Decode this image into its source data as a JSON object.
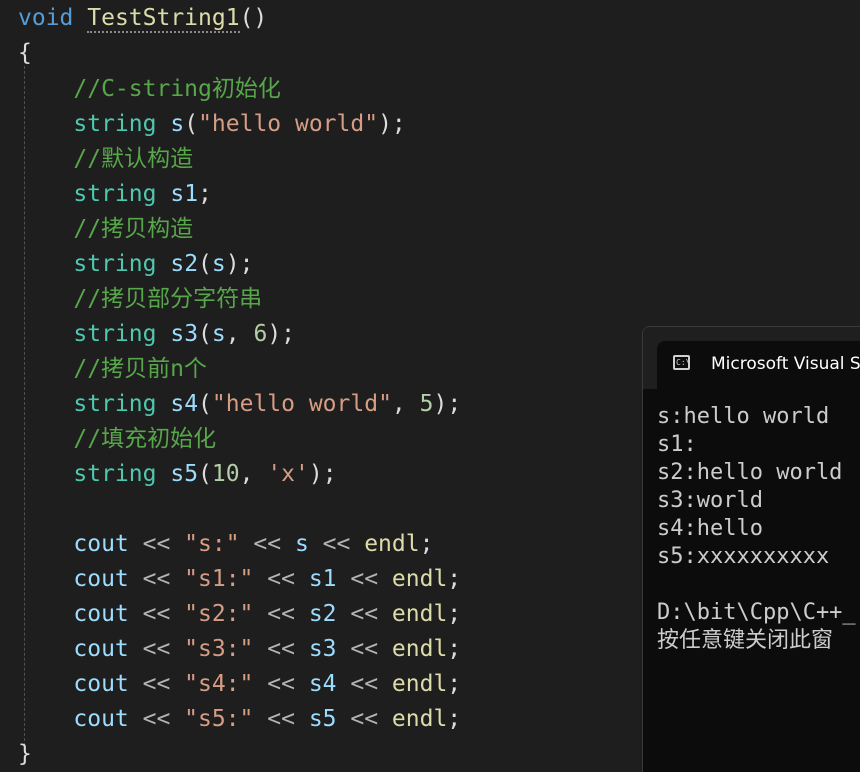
{
  "editor": {
    "lines": [
      {
        "spans": [
          {
            "t": "void",
            "c": "kw"
          },
          {
            "t": " ",
            "c": "pn"
          },
          {
            "t": "TestString1",
            "c": "fn",
            "u": true
          },
          {
            "t": "()",
            "c": "pn"
          }
        ]
      },
      {
        "spans": [
          {
            "t": "{",
            "c": "pn"
          }
        ]
      },
      {
        "spans": [
          {
            "t": "    ",
            "c": "pn"
          },
          {
            "t": "//C-string初始化",
            "c": "cm"
          }
        ]
      },
      {
        "spans": [
          {
            "t": "    ",
            "c": "pn"
          },
          {
            "t": "string",
            "c": "ty"
          },
          {
            "t": " ",
            "c": "pn"
          },
          {
            "t": "s",
            "c": "vr"
          },
          {
            "t": "(",
            "c": "pn"
          },
          {
            "t": "\"hello world\"",
            "c": "st"
          },
          {
            "t": ");",
            "c": "pn"
          }
        ]
      },
      {
        "spans": [
          {
            "t": "    ",
            "c": "pn"
          },
          {
            "t": "//默认构造",
            "c": "cm"
          }
        ]
      },
      {
        "spans": [
          {
            "t": "    ",
            "c": "pn"
          },
          {
            "t": "string",
            "c": "ty"
          },
          {
            "t": " ",
            "c": "pn"
          },
          {
            "t": "s1",
            "c": "vr"
          },
          {
            "t": ";",
            "c": "pn"
          }
        ]
      },
      {
        "spans": [
          {
            "t": "    ",
            "c": "pn"
          },
          {
            "t": "//拷贝构造",
            "c": "cm"
          }
        ]
      },
      {
        "spans": [
          {
            "t": "    ",
            "c": "pn"
          },
          {
            "t": "string",
            "c": "ty"
          },
          {
            "t": " ",
            "c": "pn"
          },
          {
            "t": "s2",
            "c": "vr"
          },
          {
            "t": "(",
            "c": "pn"
          },
          {
            "t": "s",
            "c": "vr"
          },
          {
            "t": ");",
            "c": "pn"
          }
        ]
      },
      {
        "spans": [
          {
            "t": "    ",
            "c": "pn"
          },
          {
            "t": "//拷贝部分字符串",
            "c": "cm"
          }
        ]
      },
      {
        "spans": [
          {
            "t": "    ",
            "c": "pn"
          },
          {
            "t": "string",
            "c": "ty"
          },
          {
            "t": " ",
            "c": "pn"
          },
          {
            "t": "s3",
            "c": "vr"
          },
          {
            "t": "(",
            "c": "pn"
          },
          {
            "t": "s",
            "c": "vr"
          },
          {
            "t": ", ",
            "c": "pn"
          },
          {
            "t": "6",
            "c": "nm"
          },
          {
            "t": ");",
            "c": "pn"
          }
        ]
      },
      {
        "spans": [
          {
            "t": "    ",
            "c": "pn"
          },
          {
            "t": "//拷贝前n个",
            "c": "cm"
          }
        ]
      },
      {
        "spans": [
          {
            "t": "    ",
            "c": "pn"
          },
          {
            "t": "string",
            "c": "ty"
          },
          {
            "t": " ",
            "c": "pn"
          },
          {
            "t": "s4",
            "c": "vr"
          },
          {
            "t": "(",
            "c": "pn"
          },
          {
            "t": "\"hello world\"",
            "c": "st"
          },
          {
            "t": ", ",
            "c": "pn"
          },
          {
            "t": "5",
            "c": "nm"
          },
          {
            "t": ");",
            "c": "pn"
          }
        ]
      },
      {
        "spans": [
          {
            "t": "    ",
            "c": "pn"
          },
          {
            "t": "//填充初始化",
            "c": "cm"
          }
        ]
      },
      {
        "spans": [
          {
            "t": "    ",
            "c": "pn"
          },
          {
            "t": "string",
            "c": "ty"
          },
          {
            "t": " ",
            "c": "pn"
          },
          {
            "t": "s5",
            "c": "vr"
          },
          {
            "t": "(",
            "c": "pn"
          },
          {
            "t": "10",
            "c": "nm"
          },
          {
            "t": ", ",
            "c": "pn"
          },
          {
            "t": "'x'",
            "c": "st"
          },
          {
            "t": ");",
            "c": "pn"
          }
        ]
      },
      {
        "spans": []
      },
      {
        "spans": [
          {
            "t": "    ",
            "c": "pn"
          },
          {
            "t": "cout",
            "c": "vr"
          },
          {
            "t": " << ",
            "c": "op"
          },
          {
            "t": "\"s:\"",
            "c": "st"
          },
          {
            "t": " << ",
            "c": "op"
          },
          {
            "t": "s",
            "c": "vr"
          },
          {
            "t": " << ",
            "c": "op"
          },
          {
            "t": "endl",
            "c": "fn"
          },
          {
            "t": ";",
            "c": "pn"
          }
        ]
      },
      {
        "spans": [
          {
            "t": "    ",
            "c": "pn"
          },
          {
            "t": "cout",
            "c": "vr"
          },
          {
            "t": " << ",
            "c": "op"
          },
          {
            "t": "\"s1:\"",
            "c": "st"
          },
          {
            "t": " << ",
            "c": "op"
          },
          {
            "t": "s1",
            "c": "vr"
          },
          {
            "t": " << ",
            "c": "op"
          },
          {
            "t": "endl",
            "c": "fn"
          },
          {
            "t": ";",
            "c": "pn"
          }
        ]
      },
      {
        "spans": [
          {
            "t": "    ",
            "c": "pn"
          },
          {
            "t": "cout",
            "c": "vr"
          },
          {
            "t": " << ",
            "c": "op"
          },
          {
            "t": "\"s2:\"",
            "c": "st"
          },
          {
            "t": " << ",
            "c": "op"
          },
          {
            "t": "s2",
            "c": "vr"
          },
          {
            "t": " << ",
            "c": "op"
          },
          {
            "t": "endl",
            "c": "fn"
          },
          {
            "t": ";",
            "c": "pn"
          }
        ]
      },
      {
        "spans": [
          {
            "t": "    ",
            "c": "pn"
          },
          {
            "t": "cout",
            "c": "vr"
          },
          {
            "t": " << ",
            "c": "op"
          },
          {
            "t": "\"s3:\"",
            "c": "st"
          },
          {
            "t": " << ",
            "c": "op"
          },
          {
            "t": "s3",
            "c": "vr"
          },
          {
            "t": " << ",
            "c": "op"
          },
          {
            "t": "endl",
            "c": "fn"
          },
          {
            "t": ";",
            "c": "pn"
          }
        ]
      },
      {
        "spans": [
          {
            "t": "    ",
            "c": "pn"
          },
          {
            "t": "cout",
            "c": "vr"
          },
          {
            "t": " << ",
            "c": "op"
          },
          {
            "t": "\"s4:\"",
            "c": "st"
          },
          {
            "t": " << ",
            "c": "op"
          },
          {
            "t": "s4",
            "c": "vr"
          },
          {
            "t": " << ",
            "c": "op"
          },
          {
            "t": "endl",
            "c": "fn"
          },
          {
            "t": ";",
            "c": "pn"
          }
        ]
      },
      {
        "spans": [
          {
            "t": "    ",
            "c": "pn"
          },
          {
            "t": "cout",
            "c": "vr"
          },
          {
            "t": " << ",
            "c": "op"
          },
          {
            "t": "\"s5:\"",
            "c": "st"
          },
          {
            "t": " << ",
            "c": "op"
          },
          {
            "t": "s5",
            "c": "vr"
          },
          {
            "t": " << ",
            "c": "op"
          },
          {
            "t": "endl",
            "c": "fn"
          },
          {
            "t": ";",
            "c": "pn"
          }
        ]
      },
      {
        "spans": [
          {
            "t": "}",
            "c": "pn"
          }
        ]
      }
    ]
  },
  "console": {
    "title": "Microsoft Visual St",
    "icon": "console-icon",
    "icon_glyph": "C:\\",
    "output": [
      "s:hello world",
      "s1:",
      "s2:hello world",
      "s3:world",
      "s4:hello",
      "s5:xxxxxxxxxx",
      "",
      "D:\\bit\\Cpp\\C++_",
      "按任意键关闭此窗"
    ]
  }
}
